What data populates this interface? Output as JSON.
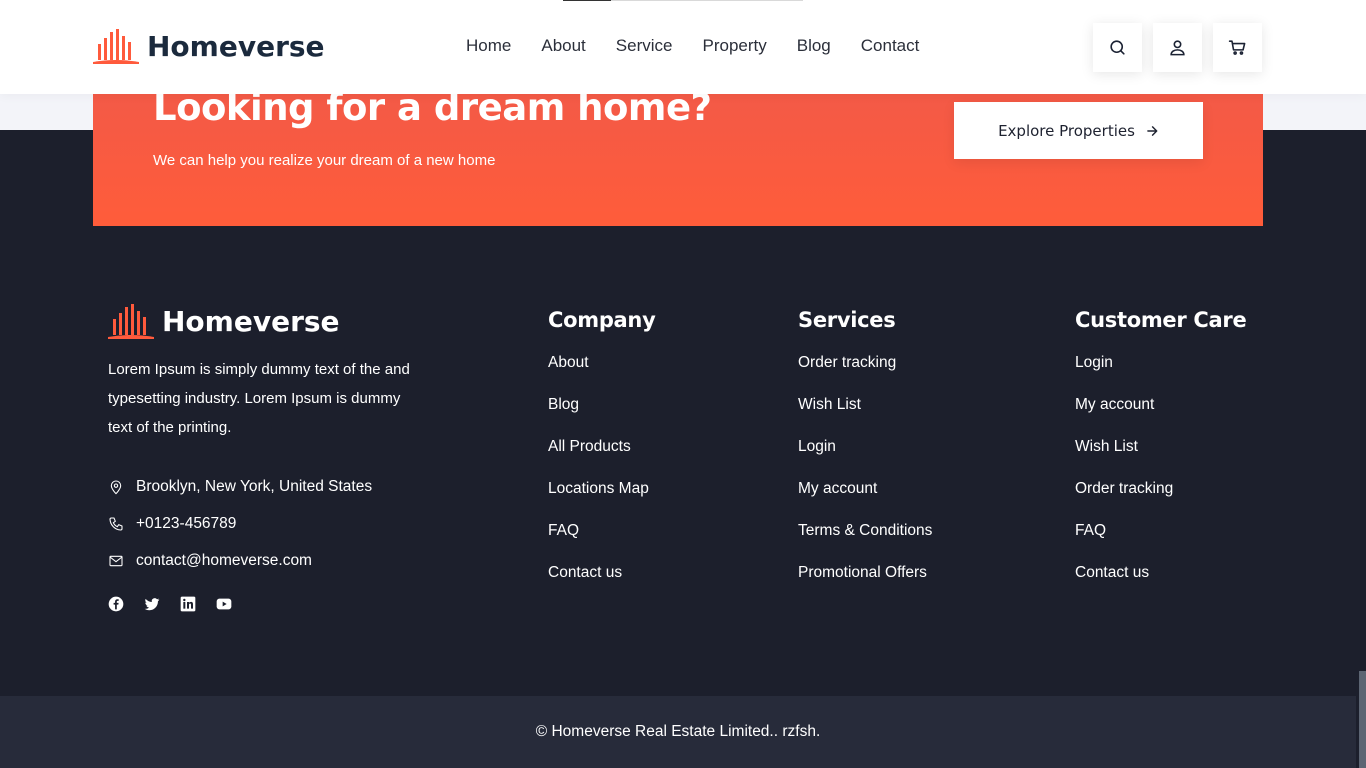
{
  "header": {
    "logo_text": "Homeverse",
    "nav": [
      "Home",
      "About",
      "Service",
      "Property",
      "Blog",
      "Contact"
    ],
    "icons": [
      "search-icon",
      "user-icon",
      "cart-icon"
    ]
  },
  "cta": {
    "title": "Looking for a dream home?",
    "subtitle": "We can help you realize your dream of a new home",
    "button_label": "Explore Properties"
  },
  "footer": {
    "logo_text": "Homeverse",
    "description": "Lorem Ipsum is simply dummy text of the and typesetting industry. Lorem Ipsum is dummy text of the printing.",
    "address": "Brooklyn, New York, United States",
    "phone": "+0123-456789",
    "email": "contact@homeverse.com",
    "socials": [
      "facebook-icon",
      "twitter-icon",
      "linkedin-icon",
      "youtube-icon"
    ],
    "columns": [
      {
        "title": "Company",
        "links": [
          "About",
          "Blog",
          "All Products",
          "Locations Map",
          "FAQ",
          "Contact us"
        ]
      },
      {
        "title": "Services",
        "links": [
          "Order tracking",
          "Wish List",
          "Login",
          "My account",
          "Terms & Conditions",
          "Promotional Offers"
        ]
      },
      {
        "title": "Customer Care",
        "links": [
          "Login",
          "My account",
          "Wish List",
          "Order tracking",
          "FAQ",
          "Contact us"
        ]
      }
    ],
    "copyright": "© Homeverse Real Estate Limited.. rzfsh."
  },
  "colors": {
    "accent": "#ff5a3c",
    "dark": "#1c1f2c",
    "bottom_bar": "#272b3a"
  }
}
